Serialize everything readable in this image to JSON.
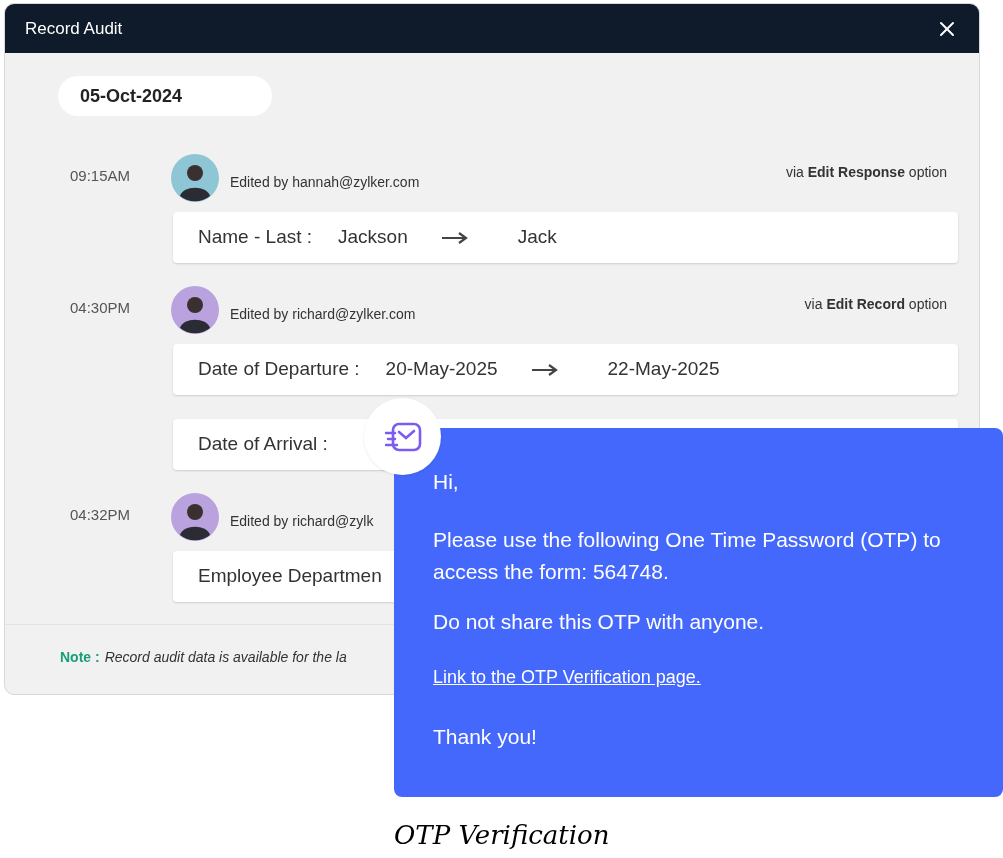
{
  "dialog": {
    "title": "Record Audit",
    "date": "05-Oct-2024",
    "entries": [
      {
        "time": "09:15AM",
        "avatar": {
          "color": "#8fc6d6"
        },
        "editor": "Edited by hannah@zylker.com",
        "source": "via **Edit Response** option",
        "changes": [
          {
            "field": "Name - Last :",
            "old": "Jackson",
            "new": "Jack"
          }
        ]
      },
      {
        "time": "04:30PM",
        "avatar": {
          "color": "#b9a2de"
        },
        "editor": "Edited by richard@zylker.com",
        "source": "via **Edit Record** option",
        "changes": [
          {
            "field": "Date of Departure :",
            "old": "20-May-2025",
            "new": "22-May-2025"
          },
          {
            "field": "Date of Arrival :"
          }
        ]
      },
      {
        "time": "04:32PM",
        "avatar": {
          "color": "#b9a2de"
        },
        "editor": "Edited by richard@zylk",
        "changes": [
          {
            "field": "Employee Departmen"
          }
        ]
      }
    ],
    "note": {
      "label": "Note :",
      "text": "Record audit data is available for the la"
    }
  },
  "otp_message": {
    "greeting": "Hi,",
    "paragraphs": [
      "Please use the following One Time Password (OTP) to access the form: 564748.",
      "Do not share this OTP with anyone."
    ],
    "link": "Link to the OTP Verification page.",
    "closing": "Thank you!",
    "caption": "OTP Verification"
  }
}
